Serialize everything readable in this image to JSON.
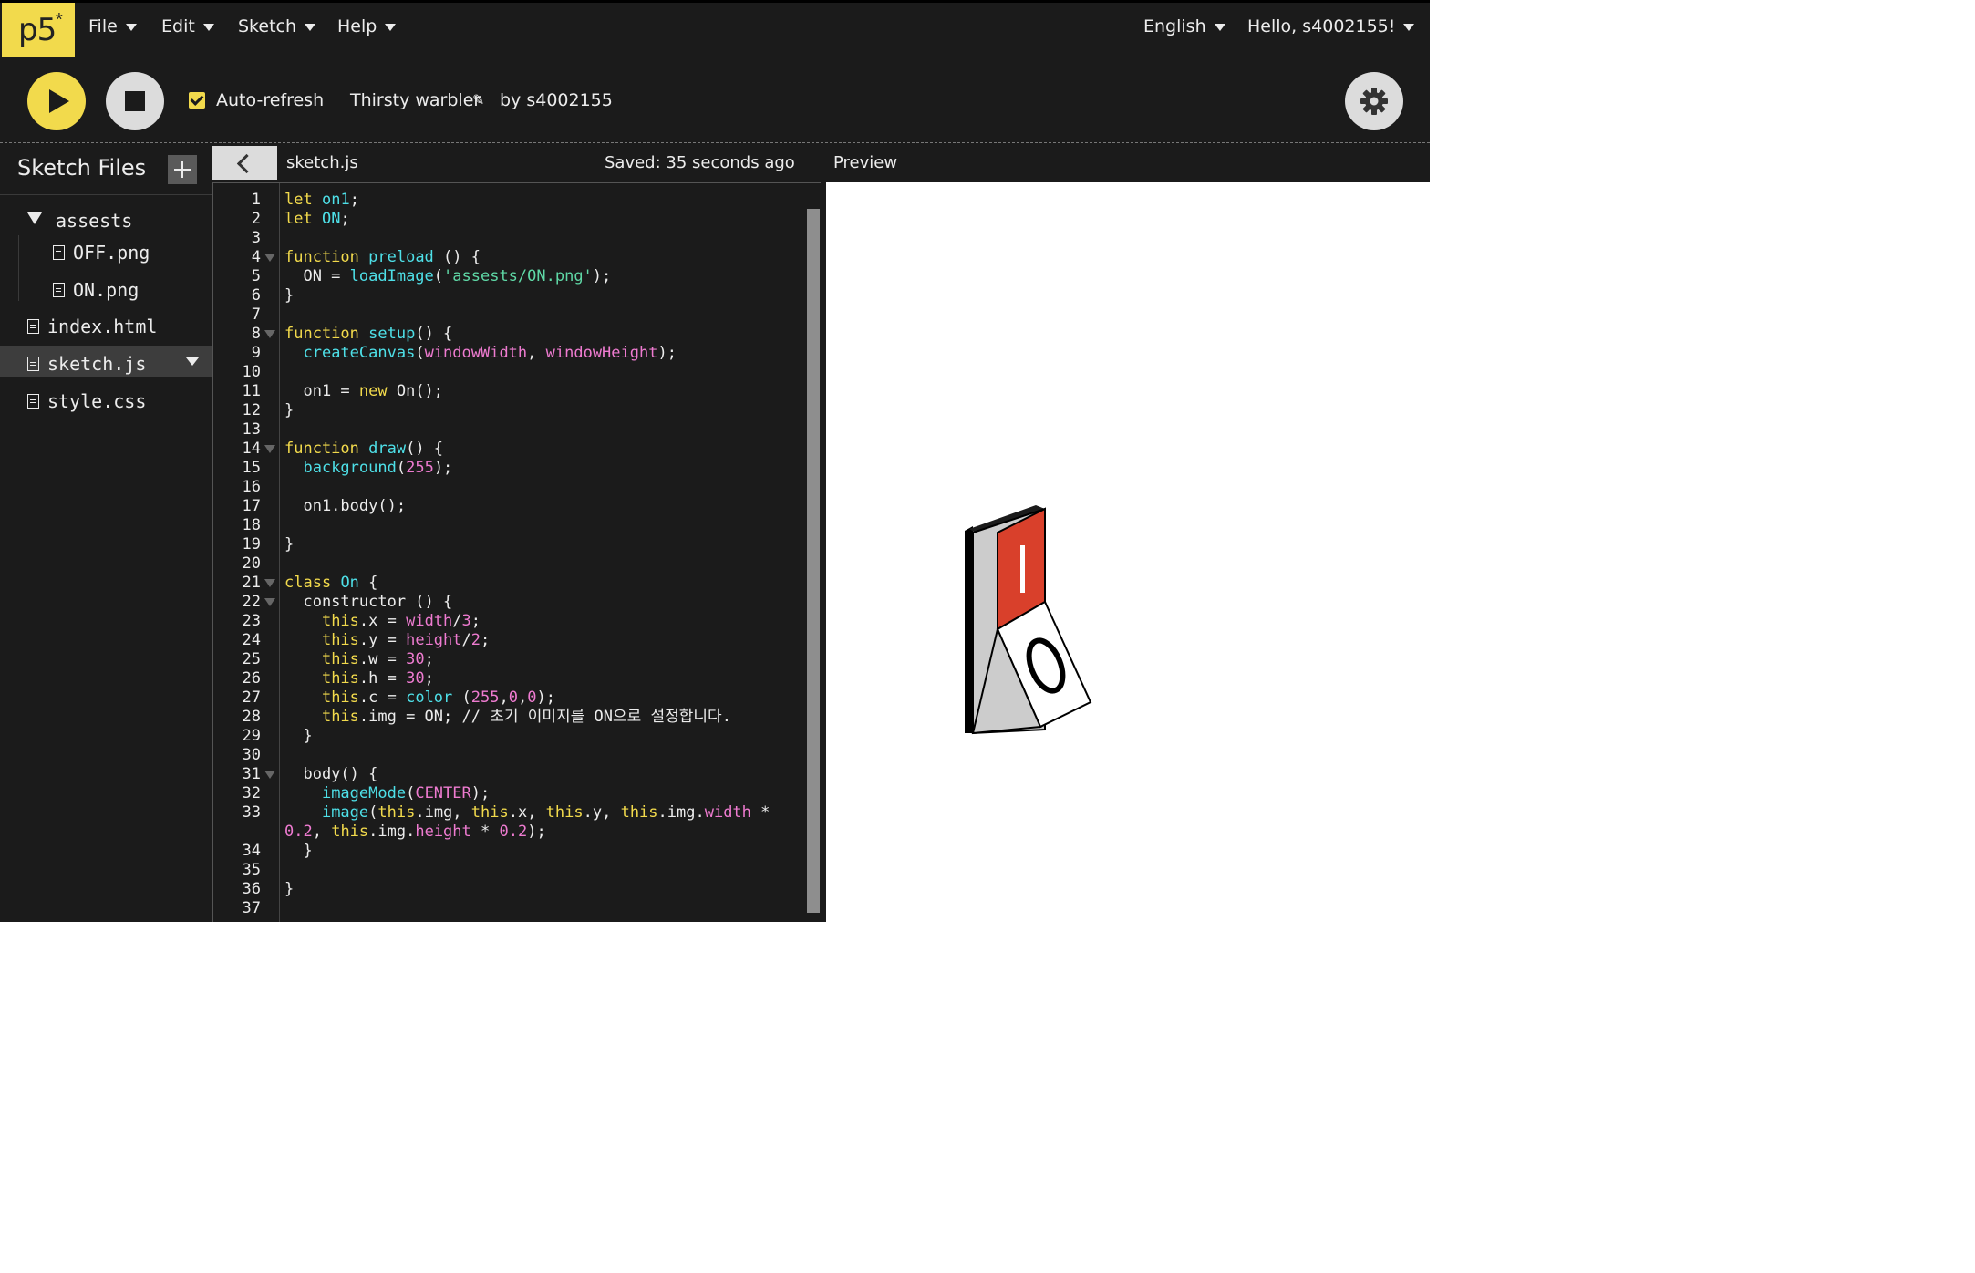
{
  "app": {
    "logo_text": "p5",
    "logo_mark": "*"
  },
  "menu": {
    "file": "File",
    "edit": "Edit",
    "sketch": "Sketch",
    "help": "Help",
    "language": "English",
    "user": "Hello, s4002155!"
  },
  "toolbar": {
    "play_icon": "play-icon",
    "stop_icon": "stop-icon",
    "auto_refresh_label": "Auto-refresh",
    "auto_refresh_checked": true,
    "sketch_name": "Thirsty warbler",
    "author": "by s4002155",
    "settings_icon": "gear-icon"
  },
  "sidebar": {
    "title": "Sketch Files",
    "files": [
      {
        "name": "assests",
        "type": "folder"
      },
      {
        "name": "OFF.png",
        "type": "file"
      },
      {
        "name": "ON.png",
        "type": "file"
      },
      {
        "name": "index.html",
        "type": "file"
      },
      {
        "name": "sketch.js",
        "type": "file",
        "selected": true
      },
      {
        "name": "style.css",
        "type": "file"
      }
    ]
  },
  "editor": {
    "file_name": "sketch.js",
    "saved_status": "Saved: 35 seconds ago",
    "line_numbers": [
      "1",
      "2",
      "3",
      "4",
      "5",
      "6",
      "7",
      "8",
      "9",
      "10",
      "11",
      "12",
      "13",
      "14",
      "15",
      "16",
      "17",
      "18",
      "19",
      "20",
      "21",
      "22",
      "23",
      "24",
      "25",
      "26",
      "27",
      "28",
      "29",
      "30",
      "31",
      "32",
      "33",
      "34",
      "35",
      "36",
      "37"
    ],
    "folded_lines": [
      "4",
      "8",
      "14",
      "21",
      "22",
      "31"
    ]
  },
  "preview": {
    "label": "Preview",
    "switch_on_symbol": "I",
    "switch_off_symbol": "O",
    "colors": {
      "switch_red": "#d9402b",
      "switch_grey": "#cccccc"
    }
  },
  "colors": {
    "accent": "#f2da4c",
    "background": "#1b1b1b",
    "keyword": "#f2da4c",
    "function": "#4ee0e8",
    "string": "#5fd8a6",
    "number": "#ee7bd0"
  }
}
